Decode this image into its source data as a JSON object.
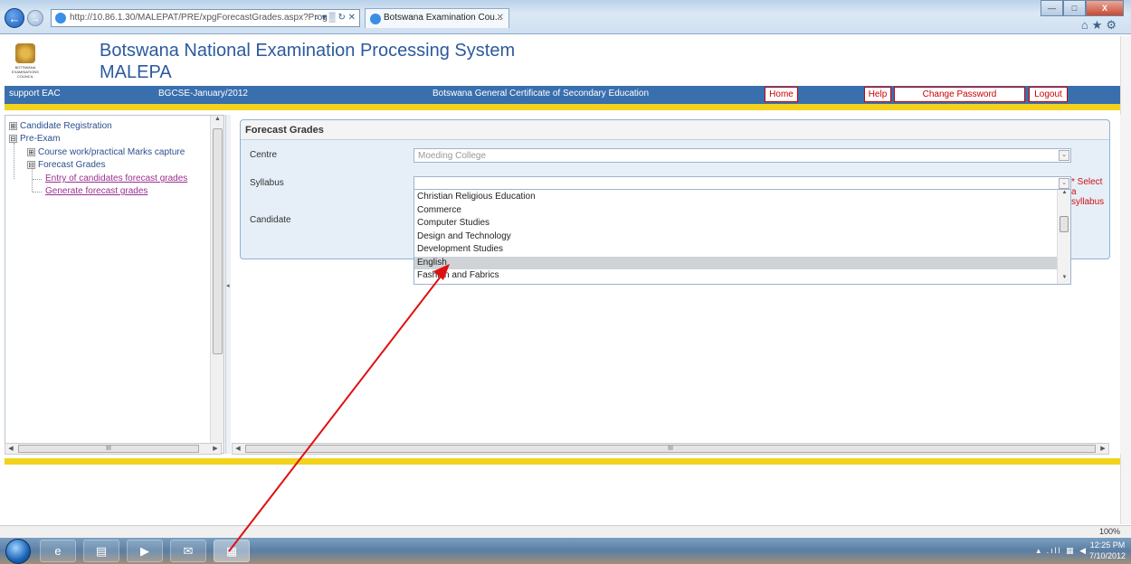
{
  "browser": {
    "address_url": "http://10.86.1.30/MALEPAT/PRE/xpgForecastGrades.aspx?Prog",
    "address_icons": "⌕ ▾ ▒ ↻ ✕",
    "tab_title": "Botswana Examination Cou...",
    "tab_close": "✕",
    "back": "←",
    "forward": "→",
    "win_min": "—",
    "win_max": "□",
    "win_close": "X",
    "toolbar_icons": "⌂★⚙"
  },
  "header": {
    "title": "Botswana National Examination Processing System",
    "subtitle": "MALEPA",
    "logo_text": "BOTSWANA EXAMINATIONS COUNCIL"
  },
  "topbar": {
    "user": "support EAC",
    "session": "BGCSE-January/2012",
    "programme": "Botswana General Certificate of Secondary Education",
    "home": "Home",
    "help": "Help",
    "change_password": "Change Password",
    "logout": "Logout"
  },
  "tree": {
    "candidate_registration": "Candidate Registration",
    "pre_exam": "Pre-Exam",
    "coursework": "Course work/practical Marks capture",
    "forecast_grades": "Forecast Grades",
    "entry_forecast": "Entry of candidates forecast grades",
    "generate_forecast": "Generate forecast grades"
  },
  "scroll": {
    "left_thumb": "III",
    "main_thumb": "III",
    "up": "▲",
    "down": "▼",
    "left": "◀",
    "right": "▶",
    "expand": "⊞",
    "collapse": "⊟",
    "splitter": "◂"
  },
  "form": {
    "title": "Forecast Grades",
    "centre_label": "Centre",
    "centre_value": "Moeding College",
    "syllabus_label": "Syllabus",
    "syllabus_value": "",
    "candidate_label": "Candidate",
    "validation": "* Select a syllabus",
    "dropdown_arrow": "⌄"
  },
  "syllabus_options": [
    "Christian Religious Education",
    "Commerce",
    "Computer Studies",
    "Design and Technology",
    "Development Studies",
    "English",
    "Fashion and Fabrics"
  ],
  "selected_option": "English",
  "status": {
    "zoom": "100%",
    "time": "12:25 PM",
    "date": "7/10/2012",
    "tray_icons": "▴ .ıll ▦ ◀"
  },
  "taskbar": {
    "items": [
      "e",
      "▤",
      "▶",
      "✉",
      "▦"
    ]
  },
  "colors": {
    "annotation_arrow": "#e01010",
    "topbar_blue": "#3a6fae",
    "accent_yellow": "#f2d21c",
    "title_blue": "#2c5a9e"
  }
}
